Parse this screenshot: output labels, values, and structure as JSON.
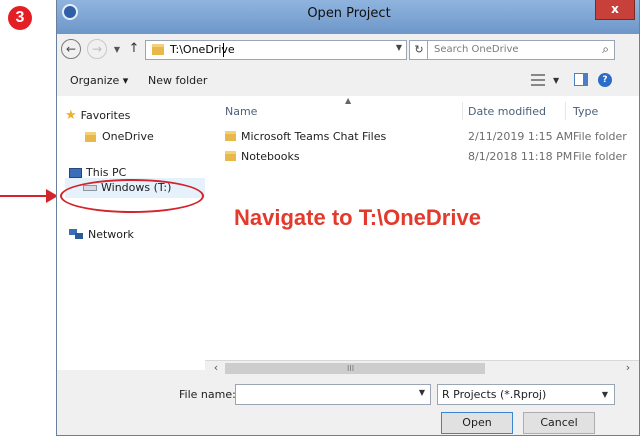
{
  "step": {
    "number": "3"
  },
  "window": {
    "title": "Open Project",
    "close_label": "x"
  },
  "nav": {
    "back": "←",
    "forward": "→",
    "up": "↑",
    "address": "T:\\OneDrive",
    "refresh": "↻",
    "search_placeholder": "Search OneDrive"
  },
  "toolbar": {
    "organize": "Organize ▾",
    "new_folder": "New folder"
  },
  "sidebar": {
    "favorites": "Favorites",
    "onedrive": "OneDrive",
    "this_pc": "This PC",
    "windows_drive": "Windows (T:)",
    "network": "Network"
  },
  "columns": {
    "name": "Name",
    "date_modified": "Date modified",
    "type": "Type"
  },
  "files": [
    {
      "name": "Microsoft Teams Chat Files",
      "date": "2/11/2019 1:15 AM",
      "type": "File folder"
    },
    {
      "name": "Notebooks",
      "date": "8/1/2018 11:18 PM",
      "type": "File folder"
    }
  ],
  "scrollbar": {
    "grip": "III"
  },
  "bottom": {
    "file_name_label": "File name:",
    "file_name_value": "",
    "filter": "R Projects (*.Rproj)",
    "open": "Open",
    "cancel": "Cancel"
  },
  "annotation": {
    "instruction": "Navigate to T:\\OneDrive",
    "color": "#e23a2d"
  }
}
